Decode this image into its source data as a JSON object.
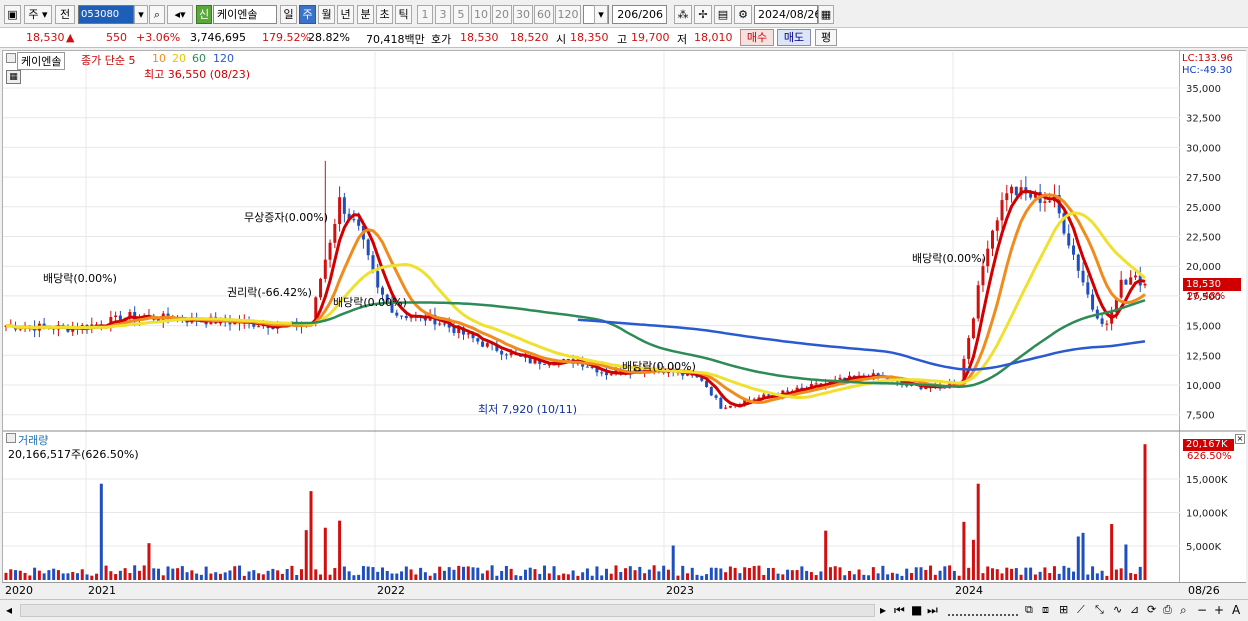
{
  "toolbar": {
    "type_label": "주",
    "prev_label": "전",
    "code": "053080",
    "stock_name": "케이엔솔",
    "new_badge": "신",
    "periods": [
      "일",
      "주",
      "월",
      "년",
      "분",
      "초",
      "틱"
    ],
    "active_period": "주",
    "counts": [
      "1",
      "3",
      "5",
      "10",
      "20",
      "30",
      "60",
      "120"
    ],
    "range": "206/206",
    "date": "2024/08/26"
  },
  "quote": {
    "price": "18,530",
    "arrow": "▲",
    "change": "550",
    "pct": "+3.06%",
    "volume": "3,746,695",
    "vol_ratio": "179.52%",
    "turnover": "28.82%",
    "amount": "70,418백만",
    "hoga_label": "호가",
    "ask": "18,530",
    "bid": "18,520",
    "open_label": "시",
    "open": "18,350",
    "high_label": "고",
    "high": "19,700",
    "low_label": "저",
    "low": "18,010",
    "buy_label": "매수",
    "sell_label": "매도",
    "avg_label": "평"
  },
  "price_panel": {
    "name": "케이엔솔",
    "legend_prefix": "종가 단순",
    "ma_labels": [
      "5",
      "10",
      "20",
      "60",
      "120"
    ],
    "ma_colors": [
      "#d00000",
      "#f08c1e",
      "#f0e030",
      "#2e8b57",
      "#2a5ad0"
    ],
    "lc": "LC:133.96",
    "hc": "HC:-49.30",
    "y_ticks": [
      "35,000",
      "32,500",
      "30,000",
      "27,500",
      "25,000",
      "22,500",
      "20,000",
      "17,500",
      "15,000",
      "12,500",
      "10,000",
      "7,500"
    ],
    "price_tag": "18,530",
    "pct_tag": "26.48%",
    "annotations": {
      "high": "최고 36,550 (08/23)",
      "low": "최저 7,920 (10/11)",
      "div1": "배당락(0.00%)",
      "div2": "배당락(0.00%)",
      "div3": "배당락(0.00%)",
      "div4": "배당락(0.00%)",
      "bonus": "무상증자(0.00%)",
      "rights": "권리락(-66.42%)"
    }
  },
  "volume_panel": {
    "title": "거래량",
    "value": "20,166,517주(626.50%)",
    "tag": "20,167K",
    "tag_pct": "626.50%",
    "y_ticks": [
      "15,000K",
      "10,000K",
      "5,000K"
    ]
  },
  "x_axis": {
    "labels": [
      "2020",
      "2021",
      "2022",
      "2023",
      "2024"
    ],
    "end_label": "08/26"
  },
  "colors": {
    "up": "#d01010",
    "down": "#1f4fbf",
    "accent": "#3a72c8"
  }
}
